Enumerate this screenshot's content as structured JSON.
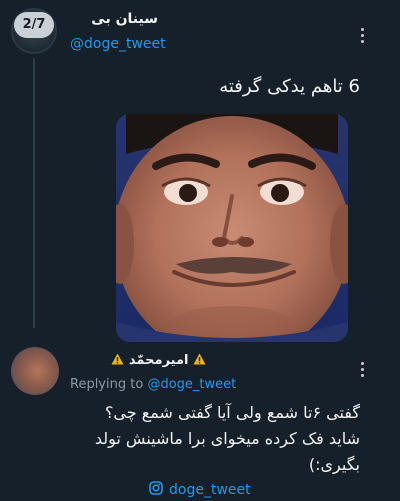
{
  "thread": {
    "counter": "2/7"
  },
  "tweet": {
    "author_name": "سینان بی",
    "author_handle": "@doge_tweet",
    "text": "6 تاهم یدکی گرفته",
    "more_icon": "more-vertical-icon",
    "image": "photo-smiling-man-face"
  },
  "reply": {
    "author_name": "امیرمحمّد",
    "author_badge_icon": "warning-icon",
    "replying_prefix": "Replying to",
    "replying_handle": "@doge_tweet",
    "lines": [
      "گفتی ۶تا شمع ولی آیا گفتی شمع چی؟",
      "شاید فک کرده میخوای برا ماشینش تولد",
      "بگیری:)"
    ],
    "more_icon": "more-vertical-icon"
  },
  "footer": {
    "icon": "instagram-icon",
    "handle": "doge_tweet"
  },
  "colors": {
    "background": "#15202b",
    "accent": "#1d9bf0",
    "warning": "#f5b400"
  }
}
